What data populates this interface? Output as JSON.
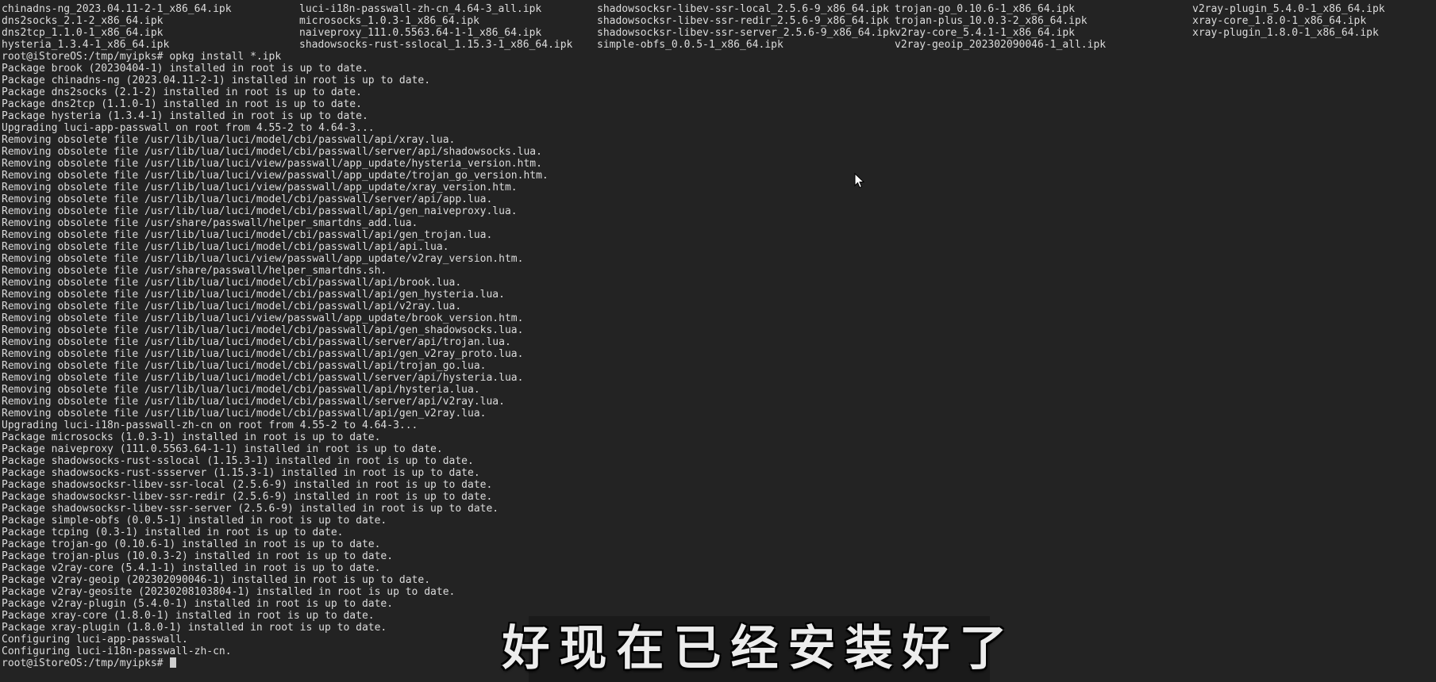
{
  "file_listing": [
    [
      "chinadns-ng_2023.04.11-2-1_x86_64.ipk",
      "luci-i18n-passwall-zh-cn_4.64-3_all.ipk",
      "shadowsocksr-libev-ssr-local_2.5.6-9_x86_64.ipk",
      "trojan-go_0.10.6-1_x86_64.ipk",
      "v2ray-plugin_5.4.0-1_x86_64.ipk"
    ],
    [
      "dns2socks_2.1-2_x86_64.ipk",
      "microsocks_1.0.3-1_x86_64.ipk",
      "shadowsocksr-libev-ssr-redir_2.5.6-9_x86_64.ipk",
      "trojan-plus_10.0.3-2_x86_64.ipk",
      "xray-core_1.8.0-1_x86_64.ipk"
    ],
    [
      "dns2tcp_1.1.0-1_x86_64.ipk",
      "naiveproxy_111.0.5563.64-1-1_x86_64.ipk",
      "shadowsocksr-libev-ssr-server_2.5.6-9_x86_64.ipk",
      "v2ray-core_5.4.1-1_x86_64.ipk",
      "xray-plugin_1.8.0-1_x86_64.ipk"
    ],
    [
      "hysteria_1.3.4-1_x86_64.ipk",
      "shadowsocks-rust-sslocal_1.15.3-1_x86_64.ipk",
      "simple-obfs_0.0.5-1_x86_64.ipk",
      "v2ray-geoip_202302090046-1_all.ipk",
      ""
    ]
  ],
  "output_lines": [
    "root@iStoreOS:/tmp/myipks# opkg install *.ipk",
    "Package brook (20230404-1) installed in root is up to date.",
    "Package chinadns-ng (2023.04.11-2-1) installed in root is up to date.",
    "Package dns2socks (2.1-2) installed in root is up to date.",
    "Package dns2tcp (1.1.0-1) installed in root is up to date.",
    "Package hysteria (1.3.4-1) installed in root is up to date.",
    "Upgrading luci-app-passwall on root from 4.55-2 to 4.64-3...",
    "Removing obsolete file /usr/lib/lua/luci/model/cbi/passwall/api/xray.lua.",
    "Removing obsolete file /usr/lib/lua/luci/model/cbi/passwall/server/api/shadowsocks.lua.",
    "Removing obsolete file /usr/lib/lua/luci/view/passwall/app_update/hysteria_version.htm.",
    "Removing obsolete file /usr/lib/lua/luci/view/passwall/app_update/trojan_go_version.htm.",
    "Removing obsolete file /usr/lib/lua/luci/view/passwall/app_update/xray_version.htm.",
    "Removing obsolete file /usr/lib/lua/luci/model/cbi/passwall/server/api/app.lua.",
    "Removing obsolete file /usr/lib/lua/luci/model/cbi/passwall/api/gen_naiveproxy.lua.",
    "Removing obsolete file /usr/share/passwall/helper_smartdns_add.lua.",
    "Removing obsolete file /usr/lib/lua/luci/model/cbi/passwall/api/gen_trojan.lua.",
    "Removing obsolete file /usr/lib/lua/luci/model/cbi/passwall/api/api.lua.",
    "Removing obsolete file /usr/lib/lua/luci/view/passwall/app_update/v2ray_version.htm.",
    "Removing obsolete file /usr/share/passwall/helper_smartdns.sh.",
    "Removing obsolete file /usr/lib/lua/luci/model/cbi/passwall/api/brook.lua.",
    "Removing obsolete file /usr/lib/lua/luci/model/cbi/passwall/api/gen_hysteria.lua.",
    "Removing obsolete file /usr/lib/lua/luci/model/cbi/passwall/api/v2ray.lua.",
    "Removing obsolete file /usr/lib/lua/luci/view/passwall/app_update/brook_version.htm.",
    "Removing obsolete file /usr/lib/lua/luci/model/cbi/passwall/api/gen_shadowsocks.lua.",
    "Removing obsolete file /usr/lib/lua/luci/model/cbi/passwall/server/api/trojan.lua.",
    "Removing obsolete file /usr/lib/lua/luci/model/cbi/passwall/api/gen_v2ray_proto.lua.",
    "Removing obsolete file /usr/lib/lua/luci/model/cbi/passwall/api/trojan_go.lua.",
    "Removing obsolete file /usr/lib/lua/luci/model/cbi/passwall/server/api/hysteria.lua.",
    "Removing obsolete file /usr/lib/lua/luci/model/cbi/passwall/api/hysteria.lua.",
    "Removing obsolete file /usr/lib/lua/luci/model/cbi/passwall/server/api/v2ray.lua.",
    "Removing obsolete file /usr/lib/lua/luci/model/cbi/passwall/api/gen_v2ray.lua.",
    "Upgrading luci-i18n-passwall-zh-cn on root from 4.55-2 to 4.64-3...",
    "Package microsocks (1.0.3-1) installed in root is up to date.",
    "Package naiveproxy (111.0.5563.64-1-1) installed in root is up to date.",
    "Package shadowsocks-rust-sslocal (1.15.3-1) installed in root is up to date.",
    "Package shadowsocks-rust-ssserver (1.15.3-1) installed in root is up to date.",
    "Package shadowsocksr-libev-ssr-local (2.5.6-9) installed in root is up to date.",
    "Package shadowsocksr-libev-ssr-redir (2.5.6-9) installed in root is up to date.",
    "Package shadowsocksr-libev-ssr-server (2.5.6-9) installed in root is up to date.",
    "Package simple-obfs (0.0.5-1) installed in root is up to date.",
    "Package tcping (0.3-1) installed in root is up to date.",
    "Package trojan-go (0.10.6-1) installed in root is up to date.",
    "Package trojan-plus (10.0.3-2) installed in root is up to date.",
    "Package v2ray-core (5.4.1-1) installed in root is up to date.",
    "Package v2ray-geoip (202302090046-1) installed in root is up to date.",
    "Package v2ray-geosite (20230208103804-1) installed in root is up to date.",
    "Package v2ray-plugin (5.4.0-1) installed in root is up to date.",
    "Package xray-core (1.8.0-1) installed in root is up to date.",
    "Package xray-plugin (1.8.0-1) installed in root is up to date.",
    "Configuring luci-app-passwall.",
    "Configuring luci-i18n-passwall-zh-cn."
  ],
  "prompt": "root@iStoreOS:/tmp/myipks# ",
  "subtitle": "好现在已经安装好了",
  "colors": {
    "background": "#232323",
    "text": "#dcdcdc",
    "cursor": "#cfcfcf",
    "subtitle_bg": "#1a1a1a"
  },
  "icons": {
    "pointer": "mouse-pointer-icon",
    "cursor": "text-cursor-block"
  }
}
